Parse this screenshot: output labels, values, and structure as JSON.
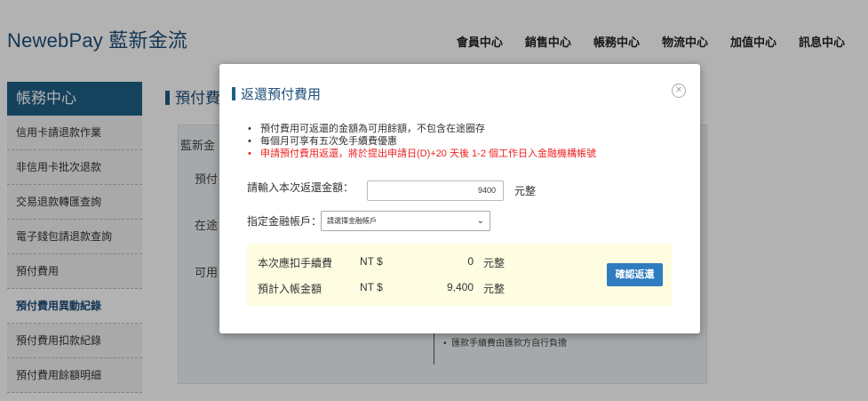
{
  "header": {
    "logo": "NewebPay 藍新金流",
    "nav": [
      "會員中心",
      "銷售中心",
      "帳務中心",
      "物流中心",
      "加值中心",
      "訊息中心"
    ]
  },
  "sidebar": {
    "title": "帳務中心",
    "items": [
      {
        "label": "信用卡請退款作業",
        "active": false
      },
      {
        "label": "非信用卡批次退款",
        "active": false
      },
      {
        "label": "交易退款轉匯查詢",
        "active": false
      },
      {
        "label": "電子錢包請退款查詢",
        "active": false
      },
      {
        "label": "預付費用",
        "active": false
      },
      {
        "label": "預付費用異動紀錄",
        "active": true
      },
      {
        "label": "預付費用扣款紀錄",
        "active": false
      },
      {
        "label": "預付費用餘額明細",
        "active": false
      }
    ]
  },
  "main": {
    "heading": "預付費",
    "labels": [
      "藍新金",
      "預付",
      "在途",
      "可用"
    ],
    "notes": [
      "匯款手續費由匯款方自行負擔"
    ]
  },
  "modal": {
    "title": "返還預付費用",
    "bullets": [
      "預付費用可返還的金額為可用餘額，不包含在途圈存",
      "每個月可享有五次免手續費優惠",
      "申請預付費用返還，將於提出申請日(D)+20 天後 1-2 個工作日入金融機構帳號"
    ],
    "amount_label": "請輸入本次返還金額：",
    "amount_value": "9400",
    "amount_unit": "元整",
    "account_label": "指定金融帳戶：",
    "account_placeholder": "請選擇金融帳戶",
    "fee_rows": [
      {
        "label": "本次應扣手續費",
        "currency": "NT $",
        "value": "0",
        "unit": "元整"
      },
      {
        "label": "預計入帳金額",
        "currency": "NT $",
        "value": "9,400",
        "unit": "元整"
      }
    ],
    "confirm_label": "確認返還"
  },
  "icons": {
    "close": "close-circle-icon",
    "chevron": "chevron-down-icon"
  },
  "colors": {
    "brand": "#1f5f86",
    "button": "#2f7cc1",
    "warning": "#e22222",
    "fee_bg": "#fffde1"
  }
}
